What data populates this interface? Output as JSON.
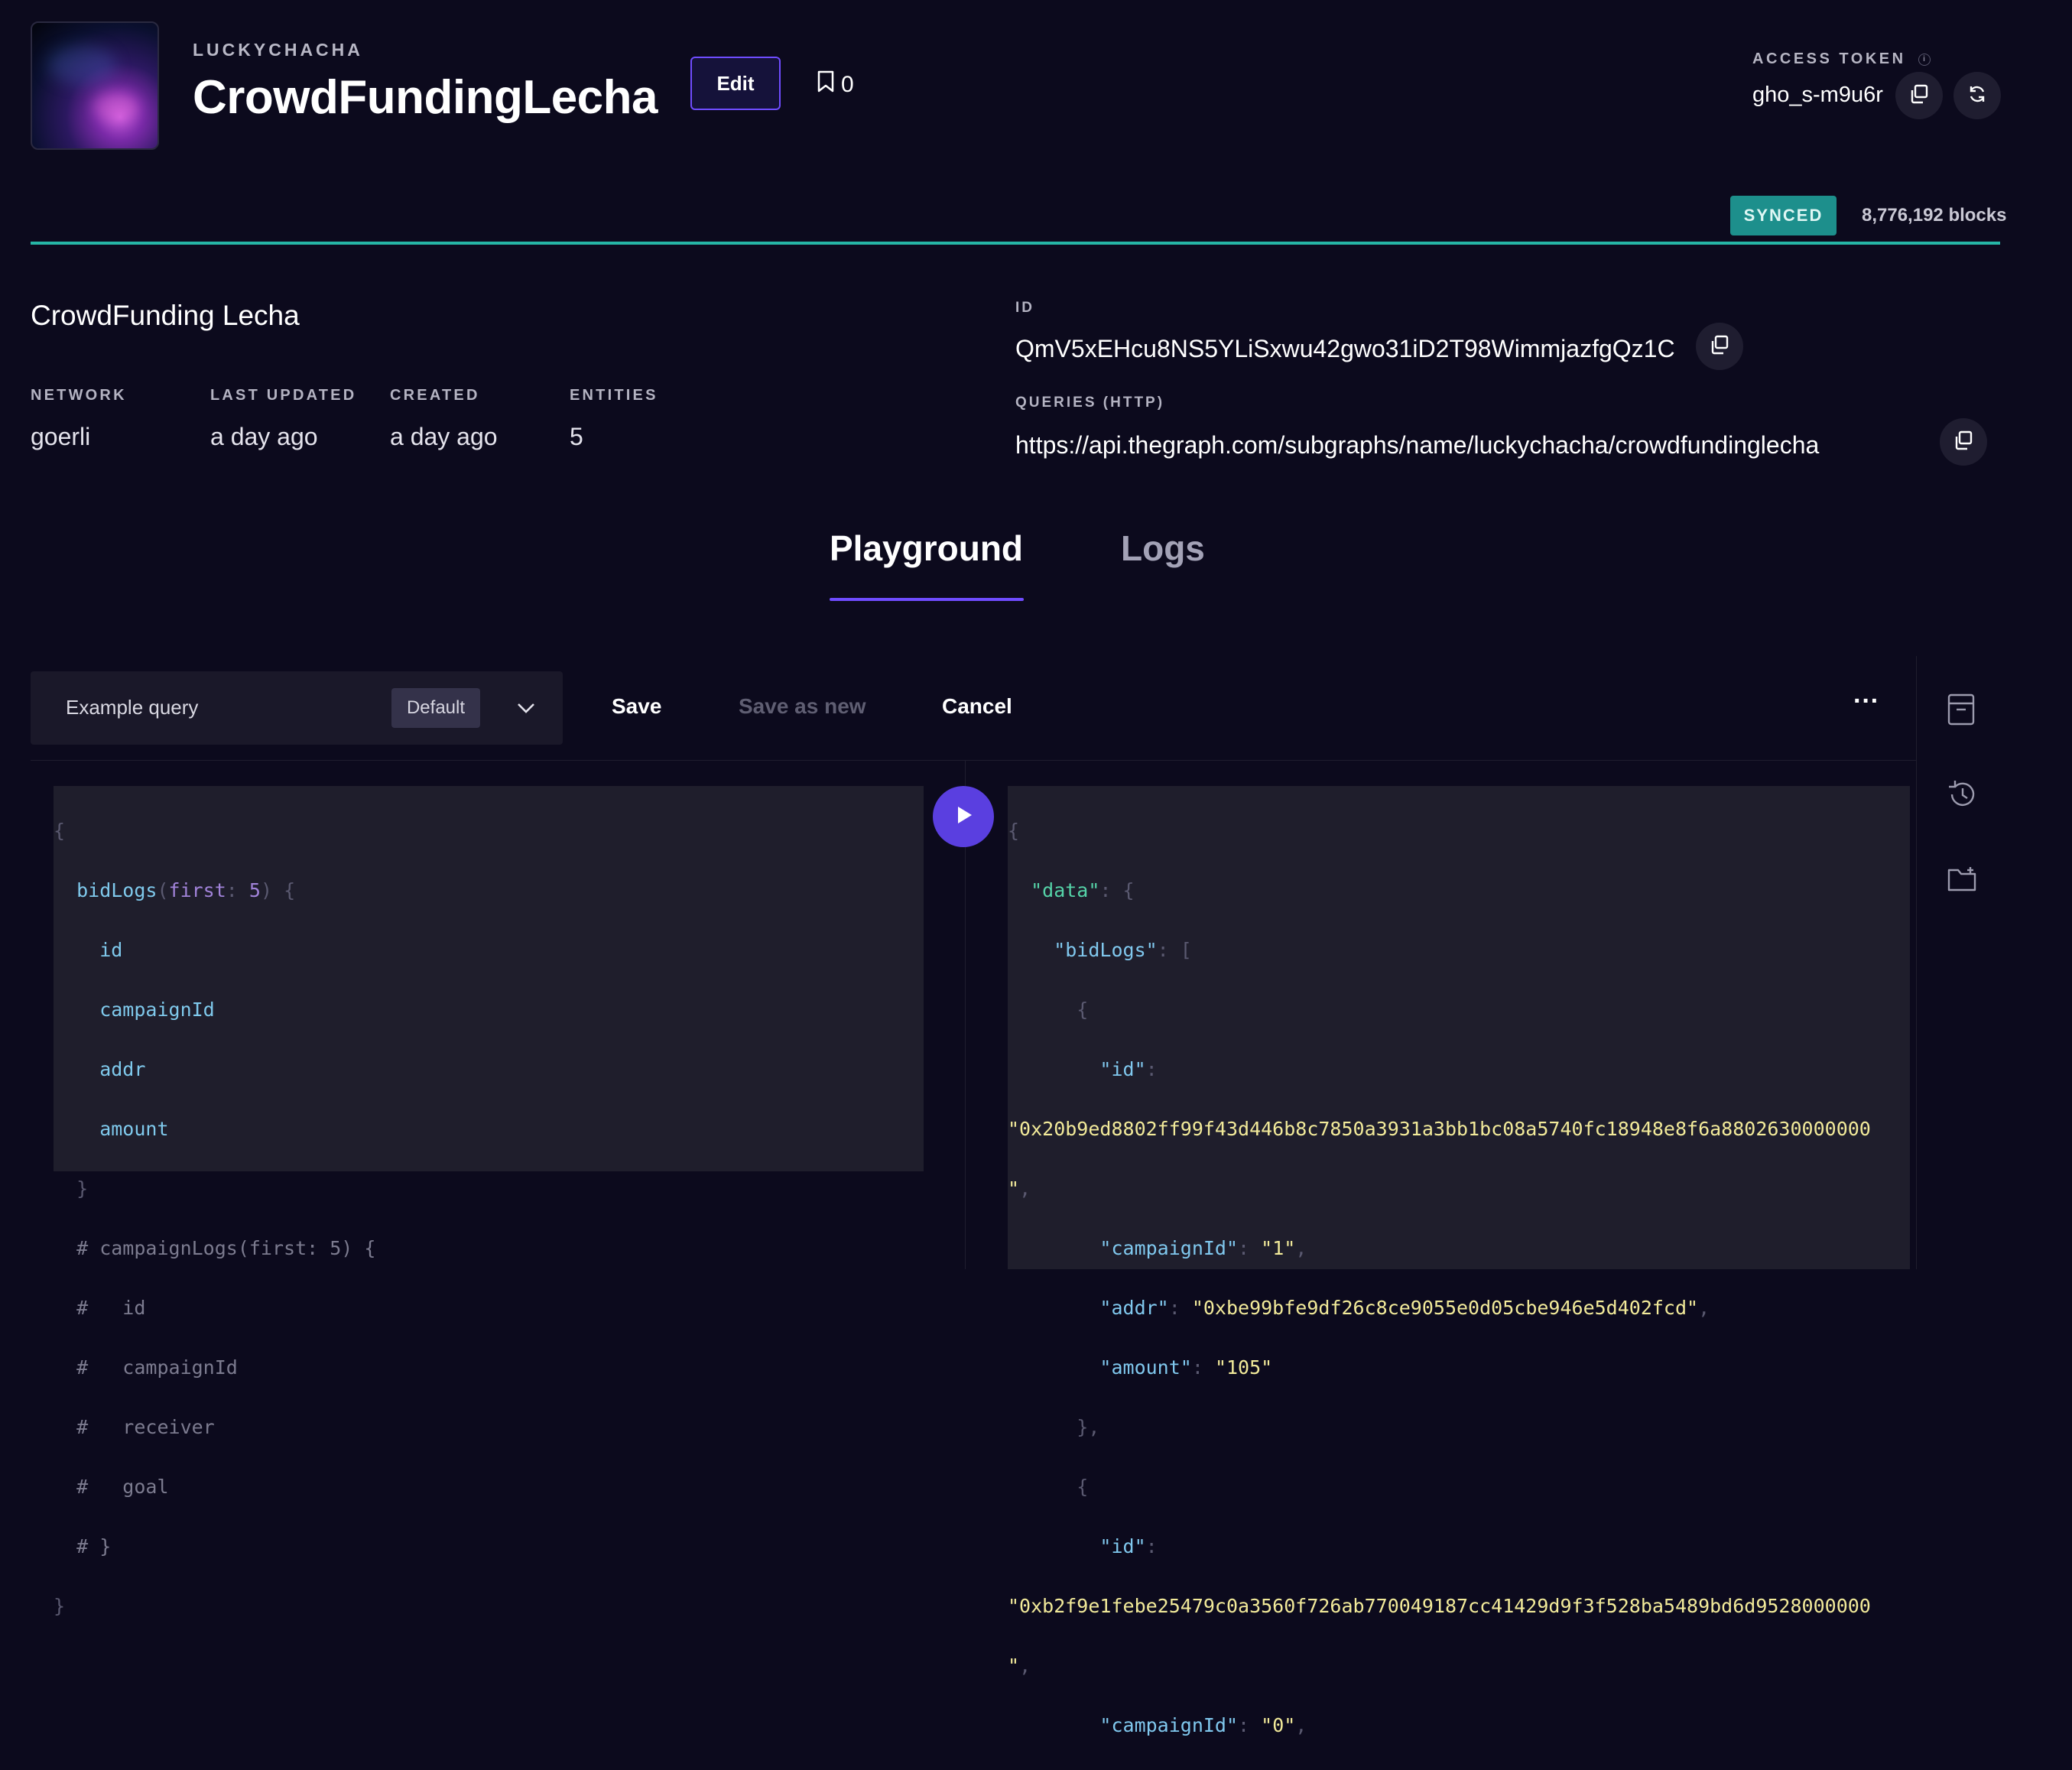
{
  "header": {
    "owner": "LUCKYCHACHA",
    "title": "CrowdFundingLecha",
    "edit_label": "Edit",
    "bookmark_count": "0",
    "access_token_label": "ACCESS TOKEN",
    "access_token_value": "gho_s-m9u6r"
  },
  "status": {
    "badge": "SYNCED",
    "blocks": "8,776,192 blocks",
    "sync_progress": 1.0,
    "color": "#1d8f8c"
  },
  "info": {
    "display_name": "CrowdFunding Lecha",
    "meta": [
      {
        "label": "NETWORK",
        "value": "goerli"
      },
      {
        "label": "LAST UPDATED",
        "value": "a day ago"
      },
      {
        "label": "CREATED",
        "value": "a day ago"
      },
      {
        "label": "ENTITIES",
        "value": "5"
      }
    ],
    "id_label": "ID",
    "id_value": "QmV5xEHcu8NS5YLiSxwu42gwo31iD2T98WimmjazfgQz1C",
    "queries_label": "QUERIES (HTTP)",
    "queries_value": "https://api.thegraph.com/subgraphs/name/luckychacha/crowdfundinglecha"
  },
  "tabs": [
    {
      "label": "Playground",
      "active": true
    },
    {
      "label": "Logs",
      "active": false
    }
  ],
  "toolbar": {
    "query_name": "Example query",
    "query_badge": "Default",
    "save_label": "Save",
    "save_as_new_label": "Save as new",
    "cancel_label": "Cancel",
    "more_label": "···"
  },
  "editor": {
    "lines": [
      "{",
      "  bidLogs(first: 5) {",
      "    id",
      "    campaignId",
      "    addr",
      "    amount",
      "  }",
      "  # campaignLogs(first: 5) {",
      "  #   id",
      "  #   campaignId",
      "  #   receiver",
      "  #   goal",
      "  # }",
      "}"
    ]
  },
  "result": {
    "lines": [
      "{",
      "  \"data\": {",
      "    \"bidLogs\": [",
      "      {",
      "        \"id\":",
      "\"0x20b9ed8802ff99f43d446b8c7850a3931a3bb1bc08a5740fc18948e8f6a8802630000000",
      "\",",
      "        \"campaignId\": \"1\",",
      "        \"addr\": \"0xbe99bfe9df26c8ce9055e0d05cbe946e5d402fcd\",",
      "        \"amount\": \"105\"",
      "      },",
      "      {",
      "        \"id\":",
      "\"0xb2f9e1febe25479c0a3560f726ab770049187cc41429d9f3f528ba5489bd6d9528000000",
      "\",",
      "        \"campaignId\": \"0\","
    ]
  },
  "colors": {
    "background": "#0c0a1d",
    "accent": "#6f4cff",
    "synced": "#1d8f8c",
    "progress": "#26b6a6"
  },
  "icons": [
    "bookmark-icon",
    "info-icon",
    "copy-icon",
    "refresh-icon",
    "chevron-down-icon",
    "play-icon",
    "more-icon",
    "docs-icon",
    "history-icon",
    "add-folder-icon"
  ]
}
